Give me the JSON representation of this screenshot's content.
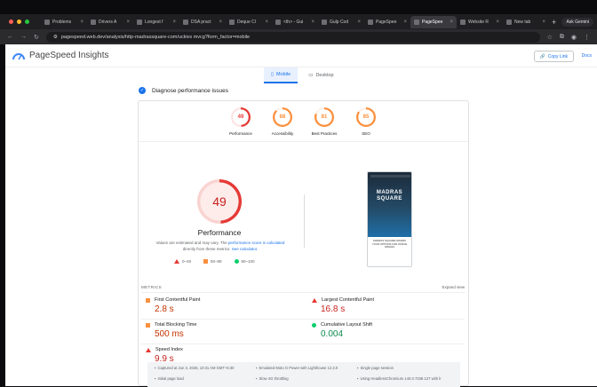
{
  "browser": {
    "tabs": [
      {
        "title": "Problems",
        "icon": "document-icon"
      },
      {
        "title": "Drivers A",
        "icon": "document-icon"
      },
      {
        "title": "Longest f",
        "icon": "document-icon"
      },
      {
        "title": "DSA pract",
        "icon": "document-icon"
      },
      {
        "title": "Deque Cl",
        "icon": "document-icon"
      },
      {
        "title": "<th> - Gui",
        "icon": "globe-icon"
      },
      {
        "title": "Gulp Cod",
        "icon": "globe-icon"
      },
      {
        "title": "PageSpee",
        "icon": "pagespeed-icon"
      },
      {
        "title": "PageSpee",
        "icon": "pagespeed-icon",
        "active": true
      },
      {
        "title": "Website R",
        "icon": "document-icon"
      },
      {
        "title": "New tab",
        "icon": "newtab-icon"
      }
    ],
    "new_tab_label": "+",
    "gemini_label": "Ask Gemini",
    "url": "pagespeed.web.dev/analysis/http-madrassquare-com/uckivs mvcg?form_factor=mobile",
    "colors": {
      "red": "#ff5f57",
      "yellow": "#febc2e",
      "green": "#28c840"
    }
  },
  "app": {
    "title": "PageSpeed Insights",
    "copy_link": "Copy Link",
    "docs": "Docs"
  },
  "device_tabs": [
    {
      "label": "Mobile",
      "icon": "mobile-icon",
      "active": true
    },
    {
      "label": "Desktop",
      "icon": "desktop-icon",
      "active": false
    }
  ],
  "diagnose_label": "Diagnose performance issues",
  "summary": [
    {
      "score": "49",
      "label": "Performance",
      "color": "#e53935",
      "level": 0.49
    },
    {
      "score": "88",
      "label": "Accessibility",
      "color": "#fa903e",
      "level": 0.88
    },
    {
      "score": "81",
      "label": "Best Practices",
      "color": "#fa903e",
      "level": 0.81
    },
    {
      "score": "85",
      "label": "SEO",
      "color": "#fa903e",
      "level": 0.85
    }
  ],
  "main_score": {
    "value": "49",
    "label": "Performance",
    "level": 0.49
  },
  "note": {
    "part1": "Values are estimated and may vary. The ",
    "link1": "performance score is calculated",
    "part2": " directly from these metrics. ",
    "link2": "See calculator."
  },
  "legend": [
    {
      "label": "0–49",
      "shape": "triangle"
    },
    {
      "label": "50–89",
      "shape": "square"
    },
    {
      "label": "90–100",
      "shape": "circle"
    }
  ],
  "screenshot": {
    "title": "MADRAS SQUARE",
    "text": "MADRAS SQUARE OFFERS YOUR OPTIONS FOR OFFICE SPACES"
  },
  "metrics": {
    "header": "METRICS",
    "expand": "Expand view",
    "items": [
      {
        "name": "First Contentful Paint",
        "value": "2.8 s",
        "status": "average",
        "color": "#c33300"
      },
      {
        "name": "Largest Contentful Paint",
        "value": "16.8 s",
        "status": "poor",
        "color": "#c5221f"
      },
      {
        "name": "Total Blocking Time",
        "value": "500 ms",
        "status": "average",
        "color": "#c33300"
      },
      {
        "name": "Cumulative Layout Shift",
        "value": "0.004",
        "status": "good",
        "color": "#0d8a4d"
      },
      {
        "name": "Speed Index",
        "value": "9.9 s",
        "status": "poor",
        "color": "#c5221f"
      }
    ]
  },
  "footer": [
    {
      "icon": "calendar-icon",
      "text": "Captured at Jun 3, 2026, 10:31 AM GMT+5:30"
    },
    {
      "icon": "device-icon",
      "text": "Emulated Moto G Power with Lighthouse 12.3.0"
    },
    {
      "icon": "user-icon",
      "text": "Single page session"
    },
    {
      "icon": "timer-icon",
      "text": "Initial page load"
    },
    {
      "icon": "network-icon",
      "text": "Slow 4G throttling"
    },
    {
      "icon": "chrome-icon",
      "text": "Using HeadlessChromium 140.0.7339.127 with lr"
    }
  ]
}
